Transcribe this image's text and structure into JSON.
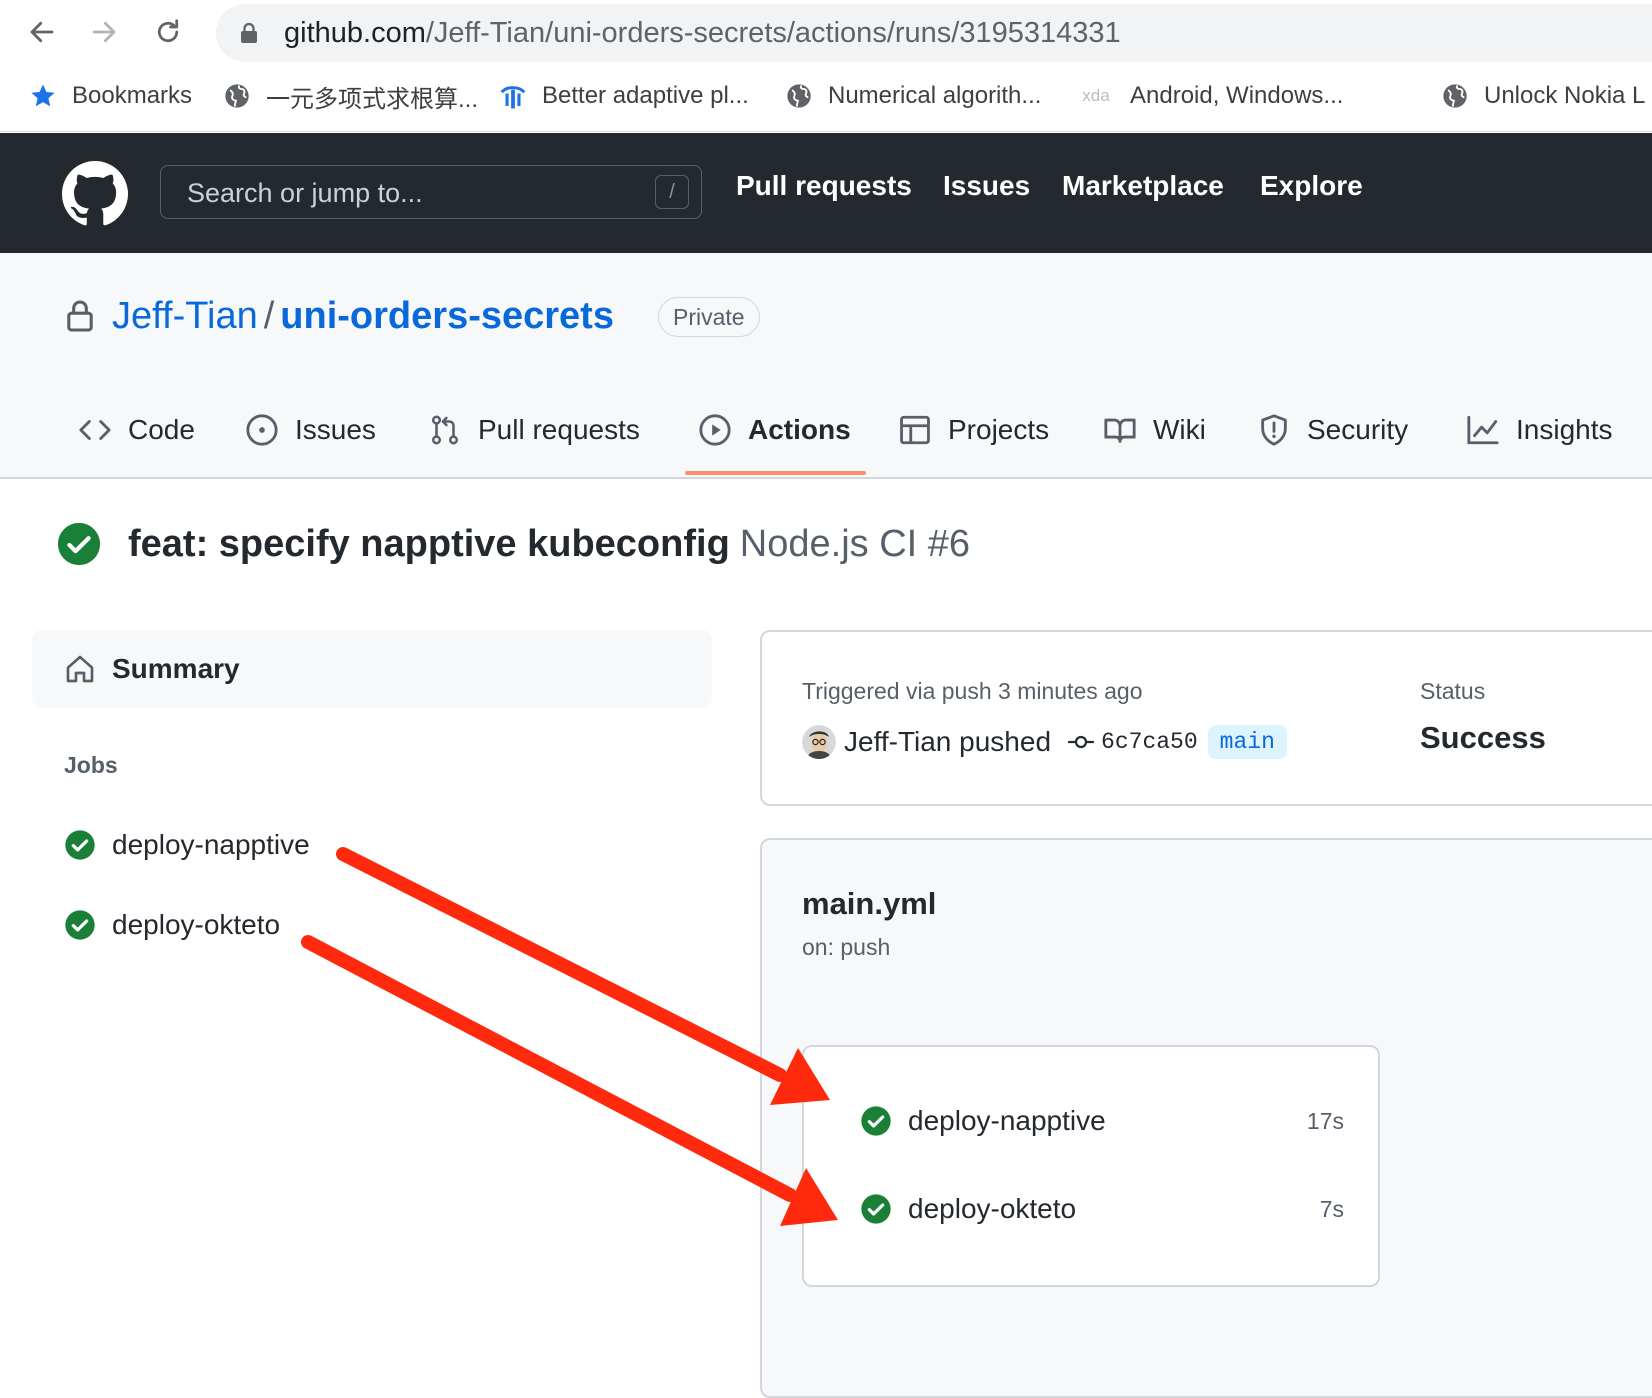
{
  "browser": {
    "url_host": "github.com",
    "url_path": "/Jeff-Tian/uni-orders-secrets/actions/runs/3195314331",
    "bookmarks": [
      {
        "label": "Bookmarks",
        "icon": "star-icon"
      },
      {
        "label": "一元多项式求根算...",
        "icon": "globe-icon"
      },
      {
        "label": "Better adaptive pl...",
        "icon": "site-logo-icon"
      },
      {
        "label": "Numerical algorith...",
        "icon": "globe-icon"
      },
      {
        "label": "Android, Windows...",
        "icon": "xda-icon",
        "icon_text": "xda"
      },
      {
        "label": "Unlock Nokia L",
        "icon": "globe-icon"
      }
    ]
  },
  "header": {
    "search_placeholder": "Search or jump to...",
    "slash_key": "/",
    "nav": [
      "Pull requests",
      "Issues",
      "Marketplace",
      "Explore"
    ]
  },
  "repo": {
    "owner": "Jeff-Tian",
    "separator": "/",
    "name": "uni-orders-secrets",
    "visibility": "Private",
    "tabs": [
      {
        "label": "Code",
        "icon": "code-icon"
      },
      {
        "label": "Issues",
        "icon": "issue-icon"
      },
      {
        "label": "Pull requests",
        "icon": "pull-request-icon"
      },
      {
        "label": "Actions",
        "icon": "play-icon",
        "selected": true
      },
      {
        "label": "Projects",
        "icon": "table-icon"
      },
      {
        "label": "Wiki",
        "icon": "book-icon"
      },
      {
        "label": "Security",
        "icon": "shield-icon"
      },
      {
        "label": "Insights",
        "icon": "graph-icon"
      }
    ]
  },
  "run": {
    "title": "feat: specify napptive kubeconfig",
    "workflow_ref": "Node.js CI #6",
    "status_icon": "check-circle-icon"
  },
  "sidebar": {
    "summary": "Summary",
    "jobs_label": "Jobs",
    "jobs": [
      "deploy-napptive",
      "deploy-okteto"
    ]
  },
  "trigger": {
    "text": "Triggered via push 3 minutes ago",
    "pusher": "Jeff-Tian pushed",
    "commit_sha": "6c7ca50",
    "branch": "main",
    "status_label": "Status",
    "status_value": "Success"
  },
  "workflow": {
    "file": "main.yml",
    "trigger": "on: push",
    "jobs": [
      {
        "name": "deploy-napptive",
        "duration": "17s"
      },
      {
        "name": "deploy-okteto",
        "duration": "7s"
      }
    ]
  },
  "colors": {
    "success": "#1a7f37",
    "link": "#0969da",
    "header_bg": "#24292f",
    "tab_underline": "#fd8c73",
    "annotation_arrow": "#ff2a0d"
  }
}
